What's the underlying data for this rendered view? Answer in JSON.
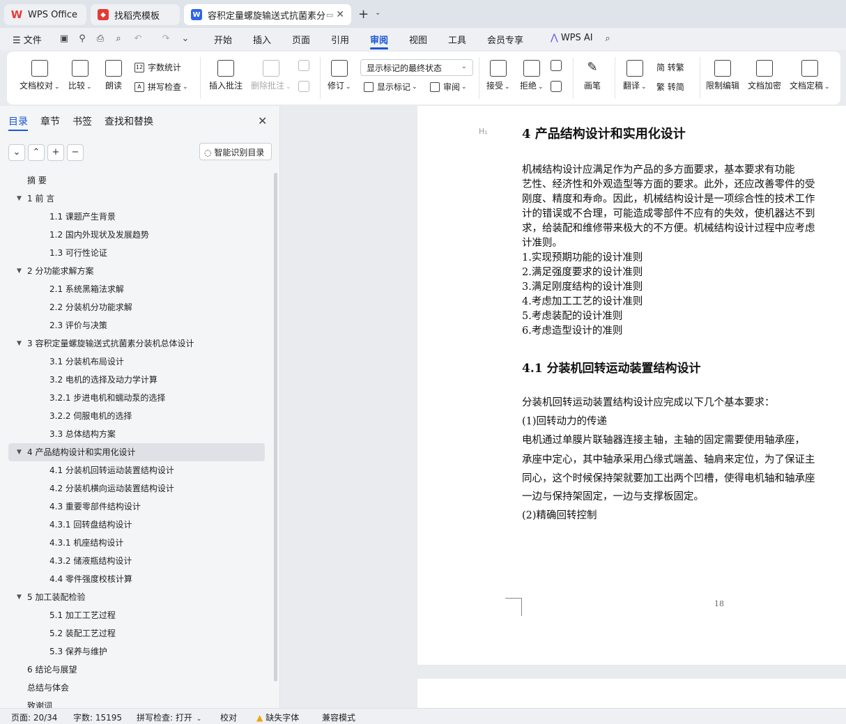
{
  "tabs": [
    {
      "label": "WPS Office",
      "icon": "wps-logo-icon"
    },
    {
      "label": "找稻壳模板",
      "icon": "template-icon"
    },
    {
      "label": "容积定量螺旋输送式抗菌素分",
      "icon": "document-icon"
    }
  ],
  "menu": {
    "file": "文件",
    "items": [
      "开始",
      "插入",
      "页面",
      "引用",
      "审阅",
      "视图",
      "工具",
      "会员专享"
    ],
    "active": "审阅",
    "ai": "WPS AI"
  },
  "ribbon": {
    "proofread": "文档校对",
    "compare": "比较",
    "read_aloud": "朗读",
    "word_count": "字数统计",
    "spell_check": "拼写检查",
    "insert_comment": "插入批注",
    "delete_comment": "删除批注",
    "revise": "修订",
    "markup_state": "显示标记的最终状态",
    "show_markup": "显示标记",
    "review": "审阅",
    "accept": "接受",
    "reject": "拒绝",
    "pen": "画笔",
    "translate": "翻译",
    "to_traditional": "简 转繁",
    "to_simplified": "繁 转简",
    "restrict_edit": "限制编辑",
    "encrypt": "文档加密",
    "finalize": "文档定稿"
  },
  "sidebar": {
    "tabs": [
      "目录",
      "章节",
      "书签",
      "查找和替换"
    ],
    "smart_toc": "智能识别目录",
    "toc": [
      {
        "text": "摘    要",
        "level": 0
      },
      {
        "text": "1 前    言",
        "level": 0,
        "expand": true
      },
      {
        "text": "1.1 课题产生背景",
        "level": 1
      },
      {
        "text": "1.2  国内外现状及发展趋势",
        "level": 1
      },
      {
        "text": "1.3  可行性论证",
        "level": 1
      },
      {
        "text": "2 分功能求解方案",
        "level": 0,
        "expand": true
      },
      {
        "text": "2.1 系统黑箱法求解",
        "level": 1
      },
      {
        "text": "2.2  分装机分功能求解",
        "level": 1
      },
      {
        "text": "2.3  评价与决策",
        "level": 1
      },
      {
        "text": "3  容积定量螺旋输送式抗菌素分装机总体设计",
        "level": 0,
        "expand": true
      },
      {
        "text": "3.1  分装机布局设计",
        "level": 1
      },
      {
        "text": "3.2  电机的选择及动力学计算",
        "level": 1
      },
      {
        "text": "3.2.1 步进电机和蠕动泵的选择",
        "level": 1
      },
      {
        "text": "3.2.2 伺服电机的选择",
        "level": 1
      },
      {
        "text": "3.3 总体结构方案",
        "level": 1
      },
      {
        "text": "4 产品结构设计和实用化设计",
        "level": 0,
        "expand": true,
        "selected": true
      },
      {
        "text": "4.1    分装机回转运动装置结构设计",
        "level": 1
      },
      {
        "text": "4.2 分装机横向运动装置结构设计",
        "level": 1
      },
      {
        "text": "4.3    重要零部件结构设计",
        "level": 1
      },
      {
        "text": "4.3.1  回转盘结构设计",
        "level": 1
      },
      {
        "text": "4.3.1  机座结构设计",
        "level": 1
      },
      {
        "text": "4.3.2 储液瓶结构设计",
        "level": 1
      },
      {
        "text": "4.4  零件强度校核计算",
        "level": 1
      },
      {
        "text": "5  加工装配检验",
        "level": 0,
        "expand": true
      },
      {
        "text": "5.1 加工工艺过程",
        "level": 1
      },
      {
        "text": "5.2 装配工艺过程",
        "level": 1
      },
      {
        "text": "5.3 保养与维护",
        "level": 1
      },
      {
        "text": "6 结论与展望",
        "level": 0
      },
      {
        "text": "总结与体会",
        "level": 0
      },
      {
        "text": "致谢词",
        "level": 0
      }
    ]
  },
  "document": {
    "heading_mark": "H₁",
    "heading": "4 产品结构设计和实用化设计",
    "intro_lines": [
      "        机械结构设计应满足作为产品的多方面要求，基本要求有功能",
      "艺性、经济性和外观造型等方面的要求。此外，还应改善零件的受",
      "刚度、精度和寿命。因此，机械结构设计是一项综合性的技术工作",
      "计的错误或不合理，可能造成零部件不应有的失效，使机器达不到",
      "求，给装配和维修带来极大的不方便。机械结构设计过程中应考虑",
      "计准则。",
      "1.实现预期功能的设计准则",
      "2.满足强度要求的设计准则",
      "3.满足刚度结构的设计准则",
      "4.考虑加工工艺的设计准则",
      "5.考虑装配的设计准则",
      "6.考虑造型设计的准则"
    ],
    "subheading": "4.1   分装机回转运动装置结构设计",
    "section_lines": [
      "      分装机回转运动装置结构设计应完成以下几个基本要求：",
      "      (1)回转动力的传递",
      "    电机通过单膜片联轴器连接主轴，主轴的固定需要使用轴承座，",
      "承座中定心，其中轴承采用凸缘式端盖、轴肩来定位，为了保证主",
      "同心，这个时候保持架就要加工出两个凹槽，使得电机轴和轴承座",
      "一边与保持架固定，一边与支撑板固定。",
      "      (2)精确回转控制"
    ],
    "page_number": "18"
  },
  "status": {
    "page": "页面: 20/34",
    "words": "字数: 15195",
    "spell": "拼写检查: 打开",
    "proof": "校对",
    "missing_font": "缺失字体",
    "compat": "兼容模式"
  }
}
